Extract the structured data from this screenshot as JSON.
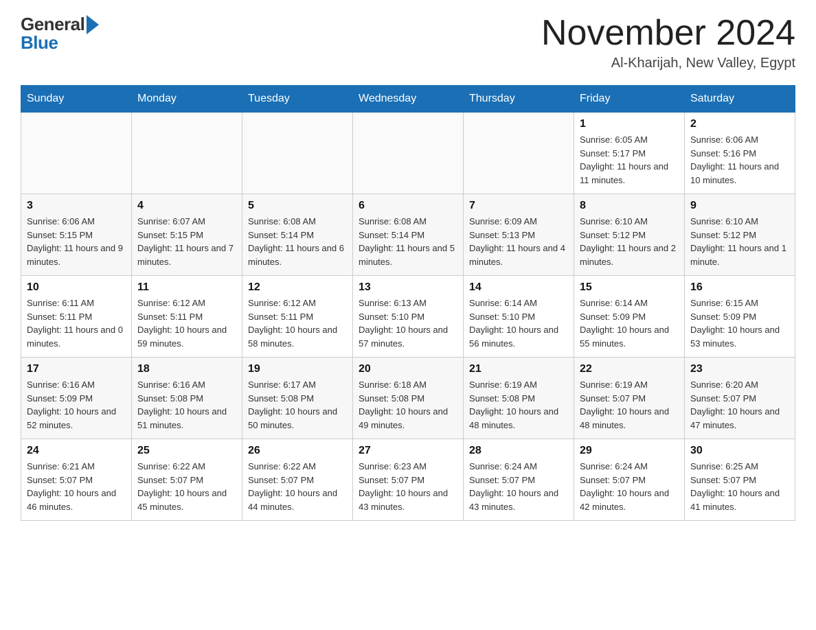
{
  "header": {
    "logo_general": "General",
    "logo_blue": "Blue",
    "month_title": "November 2024",
    "location": "Al-Kharijah, New Valley, Egypt"
  },
  "days_of_week": [
    "Sunday",
    "Monday",
    "Tuesday",
    "Wednesday",
    "Thursday",
    "Friday",
    "Saturday"
  ],
  "weeks": [
    [
      {
        "day": "",
        "sunrise": "",
        "sunset": "",
        "daylight": ""
      },
      {
        "day": "",
        "sunrise": "",
        "sunset": "",
        "daylight": ""
      },
      {
        "day": "",
        "sunrise": "",
        "sunset": "",
        "daylight": ""
      },
      {
        "day": "",
        "sunrise": "",
        "sunset": "",
        "daylight": ""
      },
      {
        "day": "",
        "sunrise": "",
        "sunset": "",
        "daylight": ""
      },
      {
        "day": "1",
        "sunrise": "Sunrise: 6:05 AM",
        "sunset": "Sunset: 5:17 PM",
        "daylight": "Daylight: 11 hours and 11 minutes."
      },
      {
        "day": "2",
        "sunrise": "Sunrise: 6:06 AM",
        "sunset": "Sunset: 5:16 PM",
        "daylight": "Daylight: 11 hours and 10 minutes."
      }
    ],
    [
      {
        "day": "3",
        "sunrise": "Sunrise: 6:06 AM",
        "sunset": "Sunset: 5:15 PM",
        "daylight": "Daylight: 11 hours and 9 minutes."
      },
      {
        "day": "4",
        "sunrise": "Sunrise: 6:07 AM",
        "sunset": "Sunset: 5:15 PM",
        "daylight": "Daylight: 11 hours and 7 minutes."
      },
      {
        "day": "5",
        "sunrise": "Sunrise: 6:08 AM",
        "sunset": "Sunset: 5:14 PM",
        "daylight": "Daylight: 11 hours and 6 minutes."
      },
      {
        "day": "6",
        "sunrise": "Sunrise: 6:08 AM",
        "sunset": "Sunset: 5:14 PM",
        "daylight": "Daylight: 11 hours and 5 minutes."
      },
      {
        "day": "7",
        "sunrise": "Sunrise: 6:09 AM",
        "sunset": "Sunset: 5:13 PM",
        "daylight": "Daylight: 11 hours and 4 minutes."
      },
      {
        "day": "8",
        "sunrise": "Sunrise: 6:10 AM",
        "sunset": "Sunset: 5:12 PM",
        "daylight": "Daylight: 11 hours and 2 minutes."
      },
      {
        "day": "9",
        "sunrise": "Sunrise: 6:10 AM",
        "sunset": "Sunset: 5:12 PM",
        "daylight": "Daylight: 11 hours and 1 minute."
      }
    ],
    [
      {
        "day": "10",
        "sunrise": "Sunrise: 6:11 AM",
        "sunset": "Sunset: 5:11 PM",
        "daylight": "Daylight: 11 hours and 0 minutes."
      },
      {
        "day": "11",
        "sunrise": "Sunrise: 6:12 AM",
        "sunset": "Sunset: 5:11 PM",
        "daylight": "Daylight: 10 hours and 59 minutes."
      },
      {
        "day": "12",
        "sunrise": "Sunrise: 6:12 AM",
        "sunset": "Sunset: 5:11 PM",
        "daylight": "Daylight: 10 hours and 58 minutes."
      },
      {
        "day": "13",
        "sunrise": "Sunrise: 6:13 AM",
        "sunset": "Sunset: 5:10 PM",
        "daylight": "Daylight: 10 hours and 57 minutes."
      },
      {
        "day": "14",
        "sunrise": "Sunrise: 6:14 AM",
        "sunset": "Sunset: 5:10 PM",
        "daylight": "Daylight: 10 hours and 56 minutes."
      },
      {
        "day": "15",
        "sunrise": "Sunrise: 6:14 AM",
        "sunset": "Sunset: 5:09 PM",
        "daylight": "Daylight: 10 hours and 55 minutes."
      },
      {
        "day": "16",
        "sunrise": "Sunrise: 6:15 AM",
        "sunset": "Sunset: 5:09 PM",
        "daylight": "Daylight: 10 hours and 53 minutes."
      }
    ],
    [
      {
        "day": "17",
        "sunrise": "Sunrise: 6:16 AM",
        "sunset": "Sunset: 5:09 PM",
        "daylight": "Daylight: 10 hours and 52 minutes."
      },
      {
        "day": "18",
        "sunrise": "Sunrise: 6:16 AM",
        "sunset": "Sunset: 5:08 PM",
        "daylight": "Daylight: 10 hours and 51 minutes."
      },
      {
        "day": "19",
        "sunrise": "Sunrise: 6:17 AM",
        "sunset": "Sunset: 5:08 PM",
        "daylight": "Daylight: 10 hours and 50 minutes."
      },
      {
        "day": "20",
        "sunrise": "Sunrise: 6:18 AM",
        "sunset": "Sunset: 5:08 PM",
        "daylight": "Daylight: 10 hours and 49 minutes."
      },
      {
        "day": "21",
        "sunrise": "Sunrise: 6:19 AM",
        "sunset": "Sunset: 5:08 PM",
        "daylight": "Daylight: 10 hours and 48 minutes."
      },
      {
        "day": "22",
        "sunrise": "Sunrise: 6:19 AM",
        "sunset": "Sunset: 5:07 PM",
        "daylight": "Daylight: 10 hours and 48 minutes."
      },
      {
        "day": "23",
        "sunrise": "Sunrise: 6:20 AM",
        "sunset": "Sunset: 5:07 PM",
        "daylight": "Daylight: 10 hours and 47 minutes."
      }
    ],
    [
      {
        "day": "24",
        "sunrise": "Sunrise: 6:21 AM",
        "sunset": "Sunset: 5:07 PM",
        "daylight": "Daylight: 10 hours and 46 minutes."
      },
      {
        "day": "25",
        "sunrise": "Sunrise: 6:22 AM",
        "sunset": "Sunset: 5:07 PM",
        "daylight": "Daylight: 10 hours and 45 minutes."
      },
      {
        "day": "26",
        "sunrise": "Sunrise: 6:22 AM",
        "sunset": "Sunset: 5:07 PM",
        "daylight": "Daylight: 10 hours and 44 minutes."
      },
      {
        "day": "27",
        "sunrise": "Sunrise: 6:23 AM",
        "sunset": "Sunset: 5:07 PM",
        "daylight": "Daylight: 10 hours and 43 minutes."
      },
      {
        "day": "28",
        "sunrise": "Sunrise: 6:24 AM",
        "sunset": "Sunset: 5:07 PM",
        "daylight": "Daylight: 10 hours and 43 minutes."
      },
      {
        "day": "29",
        "sunrise": "Sunrise: 6:24 AM",
        "sunset": "Sunset: 5:07 PM",
        "daylight": "Daylight: 10 hours and 42 minutes."
      },
      {
        "day": "30",
        "sunrise": "Sunrise: 6:25 AM",
        "sunset": "Sunset: 5:07 PM",
        "daylight": "Daylight: 10 hours and 41 minutes."
      }
    ]
  ]
}
